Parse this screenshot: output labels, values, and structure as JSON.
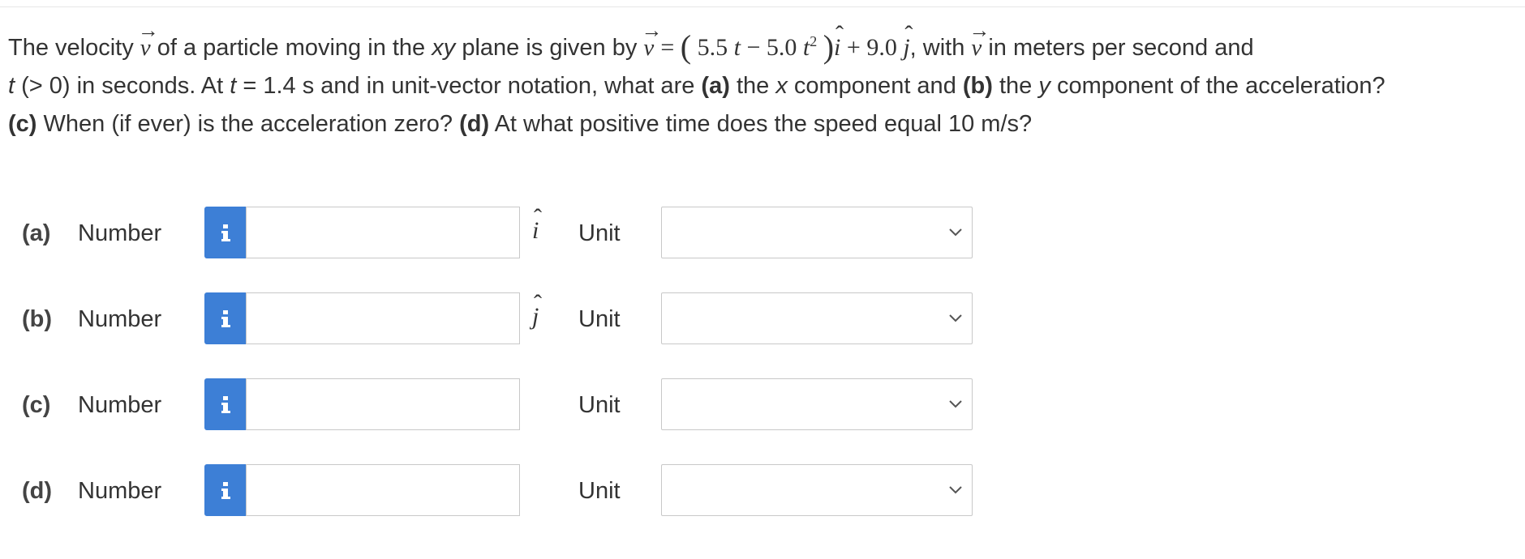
{
  "question": {
    "p1": "The velocity",
    "p2": "of a particle moving in the",
    "p2_italic": "xy",
    "p3": "plane is given by",
    "eq_equals": "=",
    "eq_a": "5.5",
    "eq_t1": "t",
    "eq_minus": "−",
    "eq_b": "5.0",
    "eq_t2": "t",
    "eq_exp": "2",
    "eq_plus": "+",
    "eq_c": "9.0",
    "p4": ", with",
    "p5": "in meters per second and",
    "t_var": "t",
    "p6": "(> 0) in seconds. At",
    "t_var2": "t",
    "p7": "= 1.4 s and in unit-vector notation, what are",
    "a_label": "(a)",
    "p8": "the",
    "x_var": "x",
    "p9": "component and",
    "b_label": "(b)",
    "p10": "the",
    "y_var": "y",
    "p11": "component of the acceleration?",
    "c_label": "(c)",
    "p12": "When (if ever) is the acceleration zero?",
    "d_label": "(d)",
    "p13": "At what positive time does the speed equal 10 m/s?",
    "v_symbol": "v",
    "i_hat": "i",
    "j_hat": "j"
  },
  "rows": [
    {
      "part": "(a)",
      "number_label": "Number",
      "info_icon": "info-icon",
      "value": "",
      "unit_vector": "i",
      "unit_label": "Unit",
      "unit_selected": ""
    },
    {
      "part": "(b)",
      "number_label": "Number",
      "info_icon": "info-icon",
      "value": "",
      "unit_vector": "j",
      "unit_label": "Unit",
      "unit_selected": ""
    },
    {
      "part": "(c)",
      "number_label": "Number",
      "info_icon": "info-icon",
      "value": "",
      "unit_vector": "",
      "unit_label": "Unit",
      "unit_selected": ""
    },
    {
      "part": "(d)",
      "number_label": "Number",
      "info_icon": "info-icon",
      "value": "",
      "unit_vector": "",
      "unit_label": "Unit",
      "unit_selected": ""
    }
  ],
  "colors": {
    "info_button": "#3d7fd6",
    "text": "#333333",
    "border": "#c8c8c8"
  }
}
